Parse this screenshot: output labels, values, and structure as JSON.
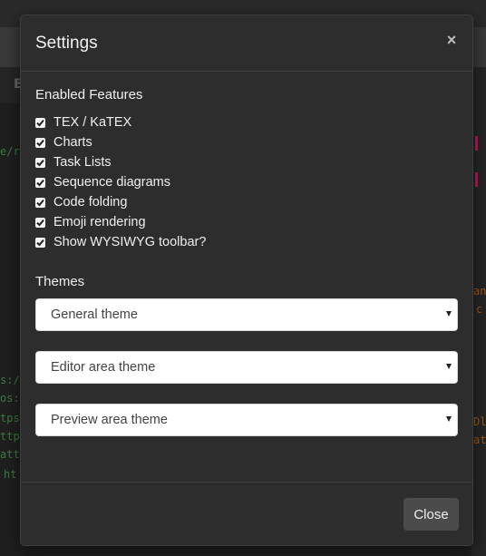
{
  "background": {
    "menubar_fragment": "E",
    "left_fragments": [
      "e/r",
      "s:/",
      "os:",
      "tps",
      "ttp",
      "att",
      "ht"
    ],
    "right_fragments": [
      "and",
      "c",
      "Dl",
      "atr"
    ]
  },
  "modal": {
    "title": "Settings",
    "close_icon": "×",
    "enabled_features_label": "Enabled Features",
    "features": [
      {
        "label": "TEX / KaTEX",
        "checked": true
      },
      {
        "label": "Charts",
        "checked": true
      },
      {
        "label": "Task Lists",
        "checked": true
      },
      {
        "label": "Sequence diagrams",
        "checked": true
      },
      {
        "label": "Code folding",
        "checked": true
      },
      {
        "label": "Emoji rendering",
        "checked": true
      },
      {
        "label": "Show WYSIWYG toolbar?",
        "checked": true
      }
    ],
    "themes_label": "Themes",
    "themes": [
      {
        "selected": "General theme"
      },
      {
        "selected": "Editor area theme"
      },
      {
        "selected": "Preview area theme"
      }
    ],
    "close_button_label": "Close"
  },
  "colors": {
    "modal_bg": "#2d2d2d",
    "overlay_bg": "#1c1c1c",
    "button_bg": "#4b4b4b",
    "code_green": "#3f7a43",
    "code_orange": "#a35a18"
  }
}
